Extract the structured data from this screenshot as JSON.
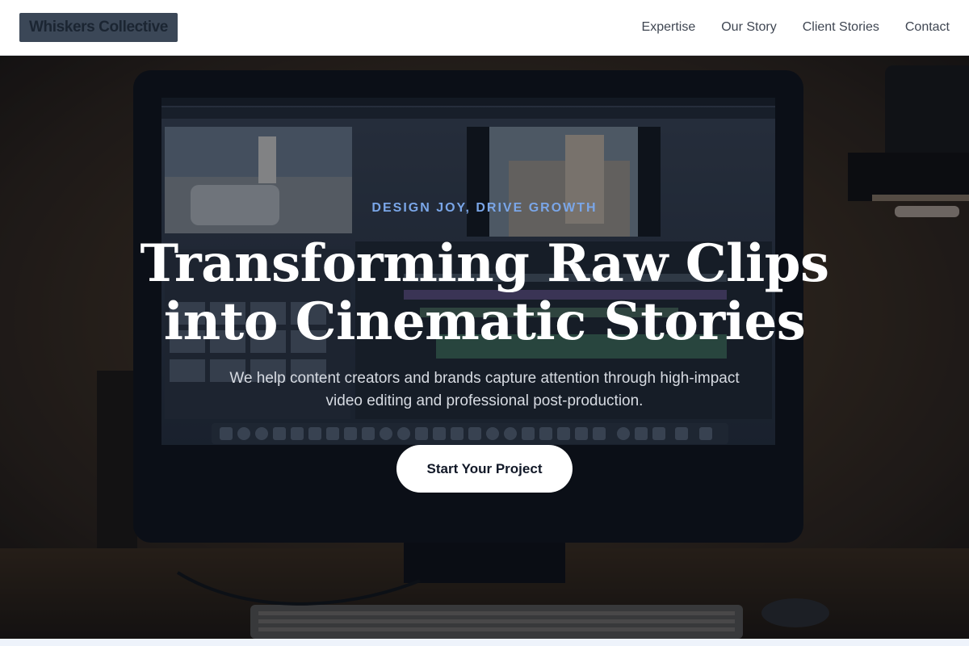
{
  "header": {
    "logo": "Whiskers Collective",
    "nav": [
      {
        "label": "Expertise"
      },
      {
        "label": "Our Story"
      },
      {
        "label": "Client Stories"
      },
      {
        "label": "Contact"
      }
    ]
  },
  "hero": {
    "tagline": "DESIGN JOY, DRIVE GROWTH",
    "headline": "Transforming Raw Clips into Cinematic Stories",
    "subtitle": "We help content creators and brands capture attention through high-impact video editing and professional post-production.",
    "cta_label": "Start Your Project"
  },
  "colors": {
    "accent": "#7aa6e8",
    "logo_bg": "#3b4757",
    "nav_text": "#3f4652"
  }
}
